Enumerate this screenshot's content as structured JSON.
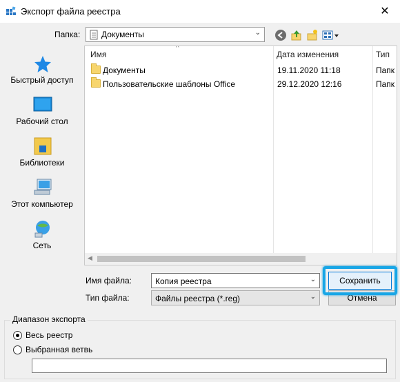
{
  "window": {
    "title": "Экспорт файла реестра",
    "close": "✕"
  },
  "folder_bar": {
    "label": "Папка:",
    "value": "Документы"
  },
  "places": [
    "Быстрый доступ",
    "Рабочий стол",
    "Библиотеки",
    "Этот компьютер",
    "Сеть"
  ],
  "file_list": {
    "columns": [
      "Имя",
      "Дата изменения",
      "Тип"
    ],
    "rows": [
      {
        "name": "Документы",
        "date": "19.11.2020 11:18",
        "type": "Папк"
      },
      {
        "name": "Пользовательские шаблоны Office",
        "date": "29.12.2020 12:16",
        "type": "Папк"
      }
    ]
  },
  "file_name": {
    "label": "Имя файла:",
    "value": "Копия реестра"
  },
  "file_type": {
    "label": "Тип файла:",
    "value": "Файлы реестра (*.reg)"
  },
  "buttons": {
    "save": "Сохранить",
    "cancel": "Отмена"
  },
  "export_range": {
    "legend": "Диапазон экспорта",
    "all_label": "Весь реестр",
    "branch_label": "Выбранная ветвь",
    "branch_value": ""
  },
  "colors": {
    "highlight": "#19a6e6",
    "accent": "#0078d7"
  }
}
